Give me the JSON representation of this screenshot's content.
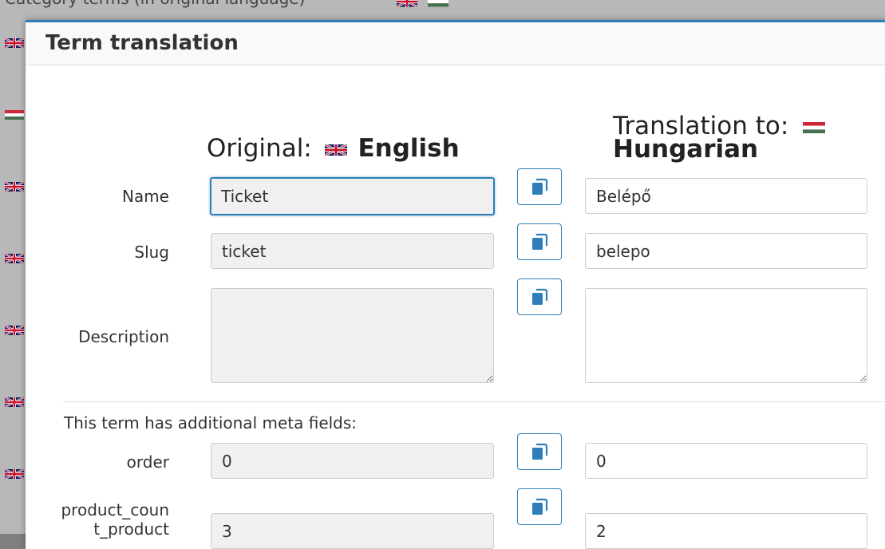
{
  "background": {
    "header_text": "Category terms (in original language)"
  },
  "dialog": {
    "title": "Term translation",
    "original_prefix": "Original:",
    "original_language": "English",
    "translation_prefix": "Translation to:",
    "translation_language": "Hungarian",
    "meta_note": "This term has additional meta fields:"
  },
  "fields": {
    "name": {
      "label": "Name",
      "original": "Ticket",
      "translation": "Belépő"
    },
    "slug": {
      "label": "Slug",
      "original": "ticket",
      "translation": "belepo"
    },
    "description": {
      "label": "Description",
      "original": "",
      "translation": ""
    },
    "order": {
      "label": "order",
      "original": "0",
      "translation": "0"
    },
    "product_count": {
      "label": "product_count_product",
      "original": "3",
      "translation": "2"
    }
  },
  "colors": {
    "accent": "#2e7fb8",
    "readonly_bg": "#f0f0f0",
    "overlay": "#808080"
  },
  "icons": {
    "copy": "copy-icon",
    "uk_flag": "uk-flag-icon",
    "hu_flag": "hungary-flag-icon"
  }
}
